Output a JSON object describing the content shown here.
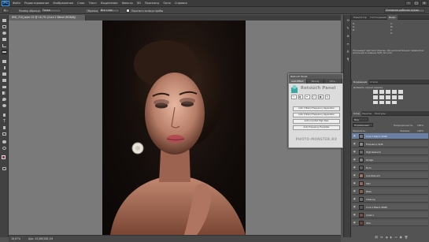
{
  "app": {
    "logo": "Ps",
    "menu": [
      "Файл",
      "Редактирование",
      "Изображение",
      "Слои",
      "Текст",
      "Выделение",
      "Фильтр",
      "3D",
      "Просмотр",
      "Окно",
      "Справка"
    ],
    "window_controls": [
      "–",
      "□",
      "×"
    ]
  },
  "options": {
    "size_label": "Размер образца:",
    "size_value": "Точка",
    "sample_label": "Образец:",
    "sample_value": "Все слои",
    "show_ring": "Показать кольцо пробы",
    "workspace": "Основная рабочая среда"
  },
  "document": {
    "tab_title": "IMG_716_layer 01 @ 16,7% (Cure 2 Blend (RGB/8))",
    "zoom": "16,67%",
    "doc_size": "Док: 45,8M/288,1M"
  },
  "retouch_panel": {
    "title": "Retouch Panel",
    "tabs": [
      "Auto Effect",
      "Beauty Retouch",
      "Ultra..."
    ],
    "name": "Retouch Panel",
    "tools": [
      "✎",
      "◐",
      "✒",
      "⚲",
      "▣",
      "⟲"
    ],
    "buttons": [
      "Auto 3 Blend Frequency Separation",
      "Auto 2 Blend Frequency Separation",
      "Auto Inverted High Pass",
      "Auto Frequency Equalizer"
    ],
    "site": "PHOTO-MONSTER.RU"
  },
  "right_panel": {
    "nav_tabs": [
      "Навигатор",
      "Гистограмма",
      "Инфо"
    ],
    "info_lines": [
      "R:",
      "G:",
      "B:",
      "C:",
      "M:",
      "Y:",
      "K:"
    ],
    "info_note": "Показывает цветовой образец. Для дополнительных параметров используйте клавиши Shift, Alt и Ctrl.",
    "adj_tabs": [
      "Коррекция",
      "Стили"
    ],
    "adj_title": "Добавить корректировку",
    "layer_tabs": [
      "Слои",
      "Каналы",
      "Контуры"
    ],
    "layer_kind": "Вид",
    "blend_mode": "Нормальные",
    "opacity_label": "Непрозрачность:",
    "opacity_value": "100%",
    "lock_label": "Закрепить:",
    "fill_label": "Заливка:",
    "fill_value": "100%",
    "layers": [
      {
        "name": "Cure 3 Blend (RGB)",
        "thumb": "#777777",
        "selected": true
      },
      {
        "name": "Frequency Split",
        "thumb": "#888888",
        "selected": false
      },
      {
        "name": "High Retouch",
        "thumb": "#6a6a6a",
        "selected": false
      },
      {
        "name": "Dodge",
        "thumb": "#7c7c7c",
        "selected": false
      },
      {
        "name": "Burn",
        "thumb": "#5e5e5e",
        "selected": false
      },
      {
        "name": "Low Retouch",
        "thumb": "#a3705a",
        "selected": false
      },
      {
        "name": "Skin",
        "thumb": "#9a6552",
        "selected": false
      },
      {
        "name": "Base",
        "thumb": "#8d5c4a",
        "selected": false
      },
      {
        "name": "Cleanup",
        "thumb": "#6d6d6d",
        "selected": false
      },
      {
        "name": "Cure 2 Blend (RGB)",
        "thumb": "#555555",
        "selected": false
      },
      {
        "name": "Слой 1",
        "thumb": "#7a4d3e",
        "selected": false
      },
      {
        "name": "Фон",
        "thumb": "#6d4335",
        "selected": false
      }
    ],
    "bottom_icons": [
      "⛓",
      "fx",
      "◑",
      "◐",
      "▭",
      "▣",
      "🗑"
    ]
  }
}
